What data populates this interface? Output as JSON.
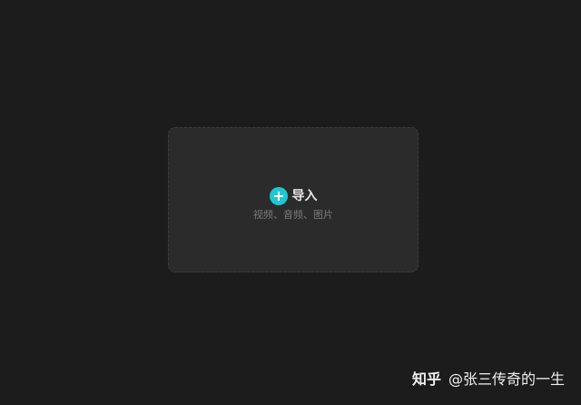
{
  "import_panel": {
    "label": "导入",
    "hint": "视频、音频、图片",
    "accent_color": "#1ec8d2",
    "icon": "plus-circle-icon"
  },
  "watermark": {
    "brand": "知乎",
    "author": "@张三传奇的一生"
  }
}
